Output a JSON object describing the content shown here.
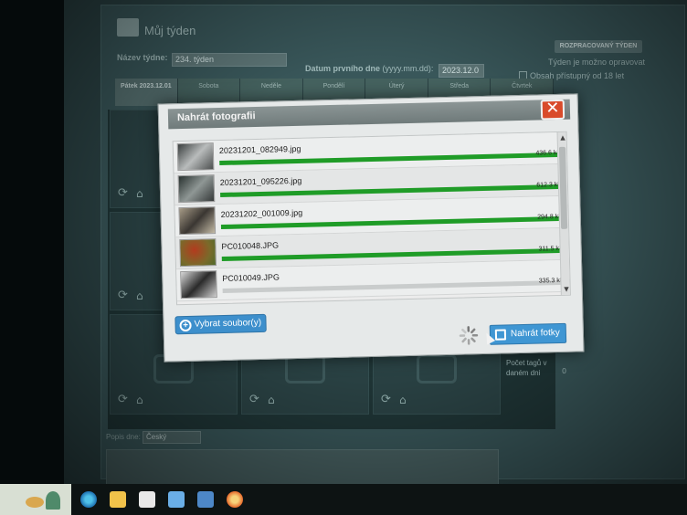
{
  "background_page": {
    "title": "Můj týden",
    "status_badge": "ROZPRACOVANÝ TÝDEN",
    "edit_note": "Týden je možno opravovat",
    "week_name_label": "Název týdne:",
    "week_name_value": "234. týden",
    "first_day_label": "Datum prvního dne",
    "first_day_hint": "(yyyy.mm.dd):",
    "first_day_value": "2023.12.0",
    "adult_checkbox_label": "Obsah přístupný od 18 let",
    "days": [
      "Pátek\n2023.12.01",
      "Sobota",
      "Neděle",
      "Pondělí",
      "Úterý",
      "Středa",
      "Čtvrtek"
    ],
    "side_note": "Počet tagů v daném dni",
    "side_note_value": "0",
    "language_label": "Popis dne:",
    "language_value": "Český"
  },
  "modal": {
    "title": "Nahrát fotografii",
    "close_glyph": "✕",
    "files": [
      {
        "name": "20231201_082949.jpg",
        "size": "436.6 kB",
        "progress": 1.0
      },
      {
        "name": "20231201_095226.jpg",
        "size": "612.3 kB",
        "progress": 1.0
      },
      {
        "name": "20231202_001009.jpg",
        "size": "294.8 kB",
        "progress": 1.0
      },
      {
        "name": "PC010048.JPG",
        "size": "311.5 kB",
        "progress": 1.0
      },
      {
        "name": "PC010049.JPG",
        "size": "335.3 kB",
        "progress": 0.0
      }
    ],
    "select_button": "Vybrat soubor(y)",
    "upload_button": "Nahrát fotky"
  },
  "colors": {
    "progress": "#1f9c27",
    "close": "#d94b2b",
    "button": "#3f96d3"
  }
}
